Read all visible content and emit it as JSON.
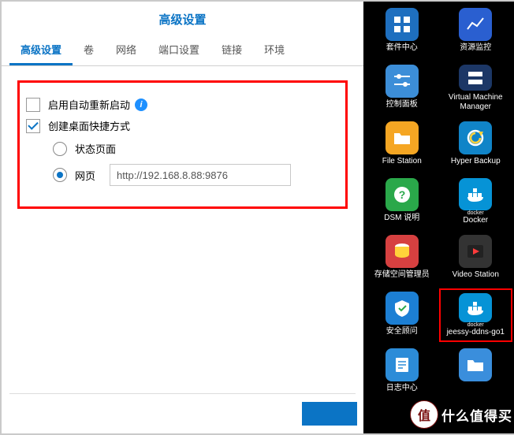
{
  "dialog": {
    "title": "高级设置",
    "tabs": [
      "高级设置",
      "卷",
      "网络",
      "端口设置",
      "链接",
      "环境"
    ],
    "active_tab": 0,
    "auto_restart_label": "启用自动重新启动",
    "auto_restart_checked": false,
    "shortcut_label": "创建桌面快捷方式",
    "shortcut_checked": true,
    "radio_status_label": "状态页面",
    "radio_web_label": "网页",
    "url_value": "http://192.168.8.88:9876"
  },
  "desktop": {
    "icons": [
      {
        "label": "套件中心",
        "bg": "#1e6fbf",
        "glyph": "grid"
      },
      {
        "label": "资源监控",
        "bg": "#2a5fd0",
        "glyph": "chart"
      },
      {
        "label": "控制面板",
        "bg": "#3c8ed8",
        "glyph": "sliders"
      },
      {
        "label": "Virtual Machine Manager",
        "bg": "#1c3766",
        "glyph": "server"
      },
      {
        "label": "File Station",
        "bg": "#f5a623",
        "glyph": "folder"
      },
      {
        "label": "Hyper Backup",
        "bg": "#1084c8",
        "glyph": "backup"
      },
      {
        "label": "DSM 说明",
        "bg": "#2aa84a",
        "glyph": "help"
      },
      {
        "label": "Docker",
        "bg": "#0693d6",
        "glyph": "docker"
      },
      {
        "label": "存储空间管理员",
        "bg": "#d64040",
        "glyph": "disk"
      },
      {
        "label": "Video Station",
        "bg": "#333333",
        "glyph": "play"
      },
      {
        "label": "安全顾问",
        "bg": "#1c7fd4",
        "glyph": "shield"
      },
      {
        "label": "jeessy-ddns-go1",
        "bg": "#0693d6",
        "glyph": "docker",
        "hl": true
      },
      {
        "label": "日志中心",
        "bg": "#2c8cd8",
        "glyph": "log"
      },
      {
        "label": "",
        "bg": "#3a8edc",
        "glyph": "folder2"
      }
    ]
  },
  "watermark": {
    "badge": "值",
    "text": "什么值得买"
  }
}
